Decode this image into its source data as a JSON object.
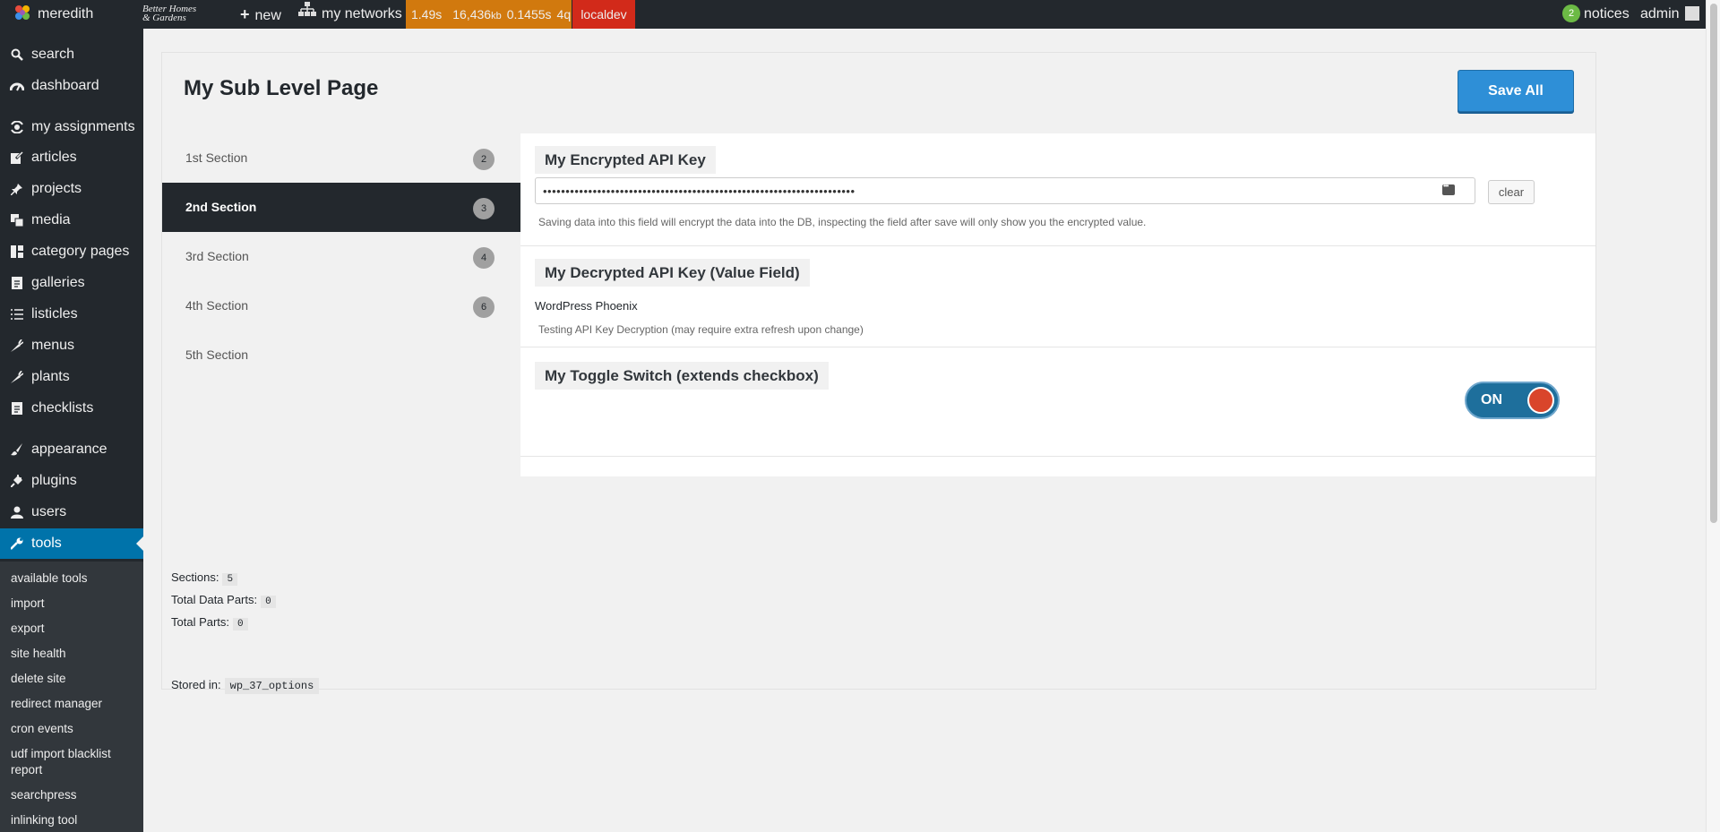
{
  "adminbar": {
    "site_name": "meredith",
    "brand": "Better Homes & Gardens",
    "new_label": "new",
    "networks_label": "my networks",
    "perf": {
      "time": "1.49s",
      "memory": "16,436",
      "memory_unit": "kb",
      "query_time": "0.1455s",
      "queries": "4q"
    },
    "env_label": "localdev",
    "notices_count": "2",
    "notices_label": "notices",
    "user_label": "admin",
    "colors": {
      "bar": "#23282d",
      "perf": "#d1790e",
      "env": "#d22a1a",
      "notice_badge": "#6cba45"
    }
  },
  "sidebar": {
    "items": [
      {
        "label": "search",
        "icon": "search-icon"
      },
      {
        "label": "dashboard",
        "icon": "dashboard-icon"
      },
      {
        "label": "my assignments",
        "icon": "assignments-icon"
      },
      {
        "label": "articles",
        "icon": "edit-icon"
      },
      {
        "label": "projects",
        "icon": "pin-icon"
      },
      {
        "label": "media",
        "icon": "media-icon"
      },
      {
        "label": "category pages",
        "icon": "grid-icon"
      },
      {
        "label": "galleries",
        "icon": "document-icon"
      },
      {
        "label": "listicles",
        "icon": "list-icon"
      },
      {
        "label": "menus",
        "icon": "carrot-icon"
      },
      {
        "label": "plants",
        "icon": "carrot-icon"
      },
      {
        "label": "checklists",
        "icon": "document-icon"
      },
      {
        "label": "appearance",
        "icon": "brush-icon"
      },
      {
        "label": "plugins",
        "icon": "plug-icon"
      },
      {
        "label": "users",
        "icon": "user-icon"
      },
      {
        "label": "tools",
        "icon": "wrench-icon"
      }
    ],
    "submenu": [
      "available tools",
      "import",
      "export",
      "site health",
      "delete site",
      "redirect manager",
      "cron events",
      "udf import blacklist report",
      "searchpress",
      "inlinking tool"
    ],
    "active_color": "#0073aa"
  },
  "page": {
    "title": "My Sub Level Page",
    "save_label": "Save All",
    "tabs": [
      {
        "label": "1st Section",
        "count": "2"
      },
      {
        "label": "2nd Section",
        "count": "3"
      },
      {
        "label": "3rd Section",
        "count": "4"
      },
      {
        "label": "4th Section",
        "count": "6"
      },
      {
        "label": "5th Section",
        "count": ""
      }
    ],
    "fields": {
      "encrypted": {
        "label": "My Encrypted API Key",
        "value": "•••••••••••••••••••••••••••••••••••••••••••••••••••••••••••••••••••••",
        "clear_label": "clear",
        "description": "Saving data into this field will encrypt the data into the DB, inspecting the field after save will only show you the encrypted value."
      },
      "decrypted": {
        "label": "My Decrypted API Key (Value Field)",
        "value": "WordPress Phoenix",
        "description": "Testing API Key Decryption (may require extra refresh upon change)"
      },
      "toggle": {
        "label": "My Toggle Switch (extends checkbox)",
        "state_label": "ON",
        "track_color": "#1e6f9c",
        "knob_color": "#d9452b"
      }
    },
    "stats": {
      "sections_label": "Sections:",
      "sections_value": "5",
      "data_parts_label": "Total Data Parts:",
      "data_parts_value": "0",
      "parts_label": "Total Parts:",
      "parts_value": "0",
      "stored_label": "Stored in:",
      "stored_value": "wp_37_options"
    }
  }
}
